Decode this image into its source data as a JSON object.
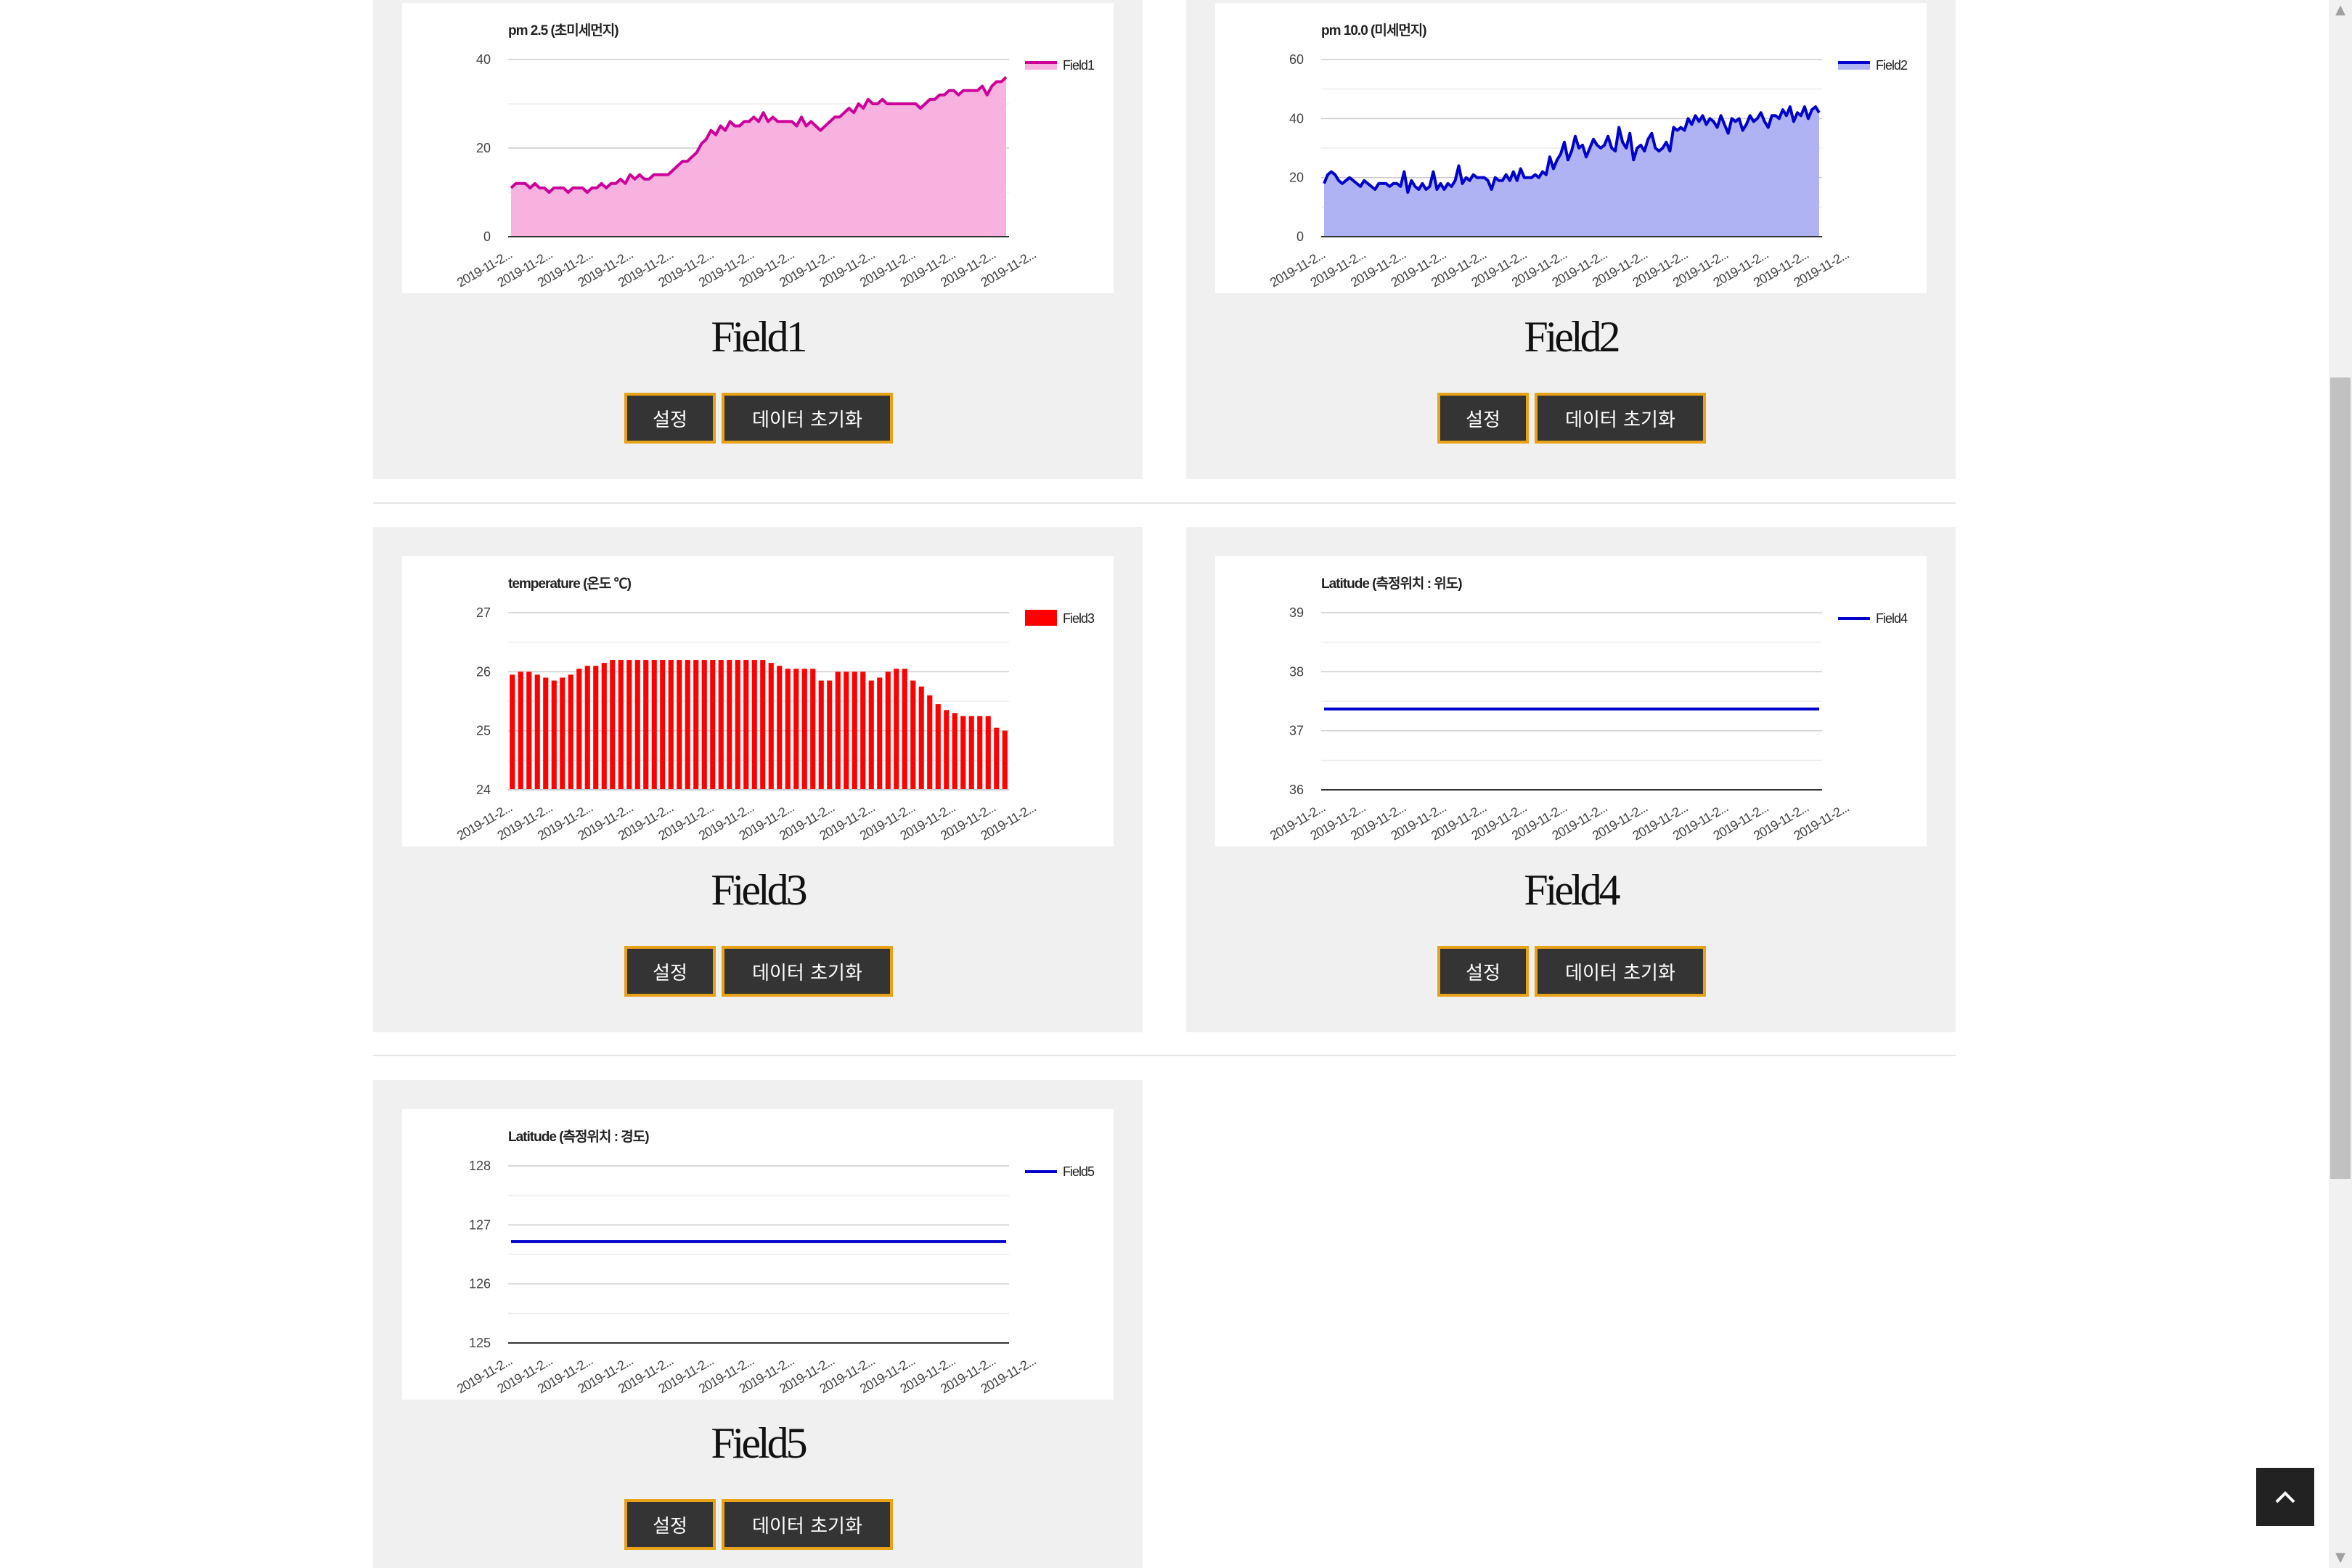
{
  "cards": [
    {
      "title": "Field1",
      "settings_label": "설정",
      "reset_label": "데이터 초기화",
      "chart_data": {
        "type": "area",
        "title": "pm 2.5 (초미세먼지)",
        "legend": "Field1",
        "legend_position": "top-right",
        "color": "#cc0099",
        "fill": "#f7b2df",
        "ylim": [
          0,
          40
        ],
        "yticks": [
          0,
          20,
          40
        ],
        "x_tick_labels": [
          "2019-11-2...",
          "2019-11-2...",
          "2019-11-2...",
          "2019-11-2...",
          "2019-11-2...",
          "2019-11-2...",
          "2019-11-2...",
          "2019-11-2...",
          "2019-11-2...",
          "2019-11-2...",
          "2019-11-2...",
          "2019-11-2...",
          "2019-11-2...",
          "2019-11-2..."
        ],
        "values": [
          11,
          12,
          12,
          12,
          11,
          12,
          11,
          11,
          10,
          11,
          11,
          11,
          10,
          11,
          11,
          11,
          10,
          11,
          11,
          12,
          11,
          12,
          12,
          13,
          12,
          14,
          13,
          14,
          13,
          13,
          14,
          14,
          14,
          14,
          15,
          16,
          17,
          17,
          18,
          19,
          21,
          22,
          24,
          23,
          25,
          24,
          26,
          25,
          25,
          26,
          26,
          27,
          26,
          28,
          26,
          27,
          26,
          26,
          26,
          26,
          25,
          27,
          25,
          26,
          25,
          24,
          25,
          26,
          27,
          27,
          28,
          29,
          28,
          30,
          29,
          31,
          30,
          30,
          31,
          30,
          30,
          30,
          30,
          30,
          30,
          30,
          29,
          30,
          31,
          31,
          32,
          32,
          33,
          33,
          32,
          33,
          33,
          33,
          33,
          34,
          32,
          34,
          35,
          35,
          36
        ]
      }
    },
    {
      "title": "Field2",
      "settings_label": "설정",
      "reset_label": "데이터 초기화",
      "chart_data": {
        "type": "area",
        "title": "pm 10.0 (미세먼지)",
        "legend": "Field2",
        "legend_position": "top-right",
        "color": "#0000cc",
        "fill": "#b0b3f3",
        "ylim": [
          0,
          60
        ],
        "yticks": [
          0,
          20,
          40,
          60
        ],
        "x_tick_labels": [
          "2019-11-2...",
          "2019-11-2...",
          "2019-11-2...",
          "2019-11-2...",
          "2019-11-2...",
          "2019-11-2...",
          "2019-11-2...",
          "2019-11-2...",
          "2019-11-2...",
          "2019-11-2...",
          "2019-11-2...",
          "2019-11-2...",
          "2019-11-2...",
          "2019-11-2..."
        ],
        "values": [
          18,
          21,
          22,
          21,
          19,
          18,
          19,
          20,
          19,
          18,
          17,
          19,
          18,
          17,
          16,
          18,
          18,
          18,
          17,
          18,
          18,
          17,
          22,
          15,
          19,
          17,
          16,
          18,
          16,
          17,
          22,
          16,
          18,
          16,
          18,
          17,
          19,
          24,
          18,
          20,
          19,
          21,
          20,
          20,
          20,
          19,
          16,
          20,
          19,
          19,
          21,
          19,
          22,
          19,
          23,
          20,
          20,
          20,
          21,
          20,
          22,
          21,
          27,
          23,
          26,
          28,
          32,
          26,
          29,
          34,
          30,
          31,
          27,
          30,
          33,
          31,
          30,
          31,
          34,
          30,
          29,
          37,
          32,
          30,
          35,
          26,
          30,
          31,
          29,
          33,
          35,
          30,
          29,
          30,
          32,
          29,
          37,
          36,
          37,
          36,
          40,
          38,
          41,
          39,
          41,
          38,
          40,
          39,
          37,
          41,
          38,
          35,
          40,
          39,
          40,
          36,
          38,
          41,
          39,
          40,
          42,
          39,
          37,
          41,
          41,
          40,
          43,
          41,
          44,
          39,
          42,
          41,
          44,
          40,
          43,
          44,
          42
        ]
      }
    },
    {
      "title": "Field3",
      "settings_label": "설정",
      "reset_label": "데이터 초기화",
      "chart_data": {
        "type": "bar",
        "title": "temperature (온도 ℃)",
        "legend": "Field3",
        "legend_position": "top-right",
        "color": "#ff0000",
        "ylim": [
          24,
          27
        ],
        "yticks": [
          24,
          25,
          26,
          27
        ],
        "x_tick_labels": [
          "2019-11-2...",
          "2019-11-2...",
          "2019-11-2...",
          "2019-11-2...",
          "2019-11-2...",
          "2019-11-2...",
          "2019-11-2...",
          "2019-11-2...",
          "2019-11-2...",
          "2019-11-2...",
          "2019-11-2...",
          "2019-11-2...",
          "2019-11-2...",
          "2019-11-2..."
        ],
        "values": [
          25.95,
          26.0,
          26.0,
          25.95,
          25.9,
          25.85,
          25.9,
          25.95,
          26.05,
          26.1,
          26.1,
          26.15,
          26.2,
          26.2,
          26.2,
          26.2,
          26.2,
          26.2,
          26.2,
          26.2,
          26.2,
          26.2,
          26.2,
          26.2,
          26.2,
          26.2,
          26.2,
          26.2,
          26.2,
          26.2,
          26.2,
          26.15,
          26.1,
          26.05,
          26.05,
          26.05,
          26.05,
          25.85,
          25.85,
          26.0,
          26.0,
          26.0,
          26.0,
          25.85,
          25.9,
          26.0,
          26.05,
          26.05,
          25.85,
          25.75,
          25.6,
          25.45,
          25.35,
          25.3,
          25.25,
          25.25,
          25.25,
          25.25,
          25.05,
          25.0
        ]
      }
    },
    {
      "title": "Field4",
      "settings_label": "설정",
      "reset_label": "데이터 초기화",
      "chart_data": {
        "type": "line",
        "title": "Latitude (측정위치 : 위도)",
        "legend": "Field4",
        "legend_position": "top-right",
        "color": "#0000cc",
        "ylim": [
          36,
          39
        ],
        "yticks": [
          36,
          37,
          38,
          39
        ],
        "x_tick_labels": [
          "2019-11-2...",
          "2019-11-2...",
          "2019-11-2...",
          "2019-11-2...",
          "2019-11-2...",
          "2019-11-2...",
          "2019-11-2...",
          "2019-11-2...",
          "2019-11-2...",
          "2019-11-2...",
          "2019-11-2...",
          "2019-11-2...",
          "2019-11-2...",
          "2019-11-2..."
        ],
        "values": [
          37.37,
          37.37
        ]
      }
    },
    {
      "title": "Field5",
      "settings_label": "설정",
      "reset_label": "데이터 초기화",
      "chart_data": {
        "type": "line",
        "title": "Latitude (측정위치 : 경도)",
        "legend": "Field5",
        "legend_position": "top-right",
        "color": "#0000cc",
        "ylim": [
          125,
          128
        ],
        "yticks": [
          125,
          126,
          127,
          128
        ],
        "x_tick_labels": [
          "2019-11-2...",
          "2019-11-2...",
          "2019-11-2...",
          "2019-11-2...",
          "2019-11-2...",
          "2019-11-2...",
          "2019-11-2...",
          "2019-11-2...",
          "2019-11-2...",
          "2019-11-2...",
          "2019-11-2...",
          "2019-11-2...",
          "2019-11-2...",
          "2019-11-2..."
        ],
        "values": [
          126.72,
          126.72
        ]
      }
    }
  ],
  "scroll_top_icon": "chevron-up-icon",
  "colors": {
    "button_bg": "#343434",
    "button_border": "#e8a21a",
    "card_bg": "#f0f0f0"
  }
}
